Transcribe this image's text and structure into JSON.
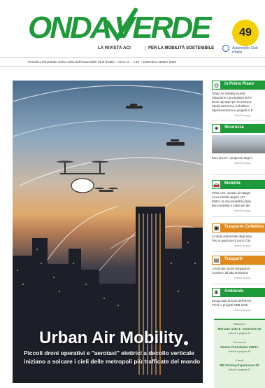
{
  "masthead": {
    "logo_left": "ONDA",
    "logo_right": "VERDE",
    "issue_number": "49",
    "tagline_left": "LA RIVISTA ACI",
    "tagline_right": "PER LA MOBILITÀ SOSTENIBILE",
    "aci_label": "Automobile Club d'Italia",
    "subtitle": "Periodico bimestrale online edito dall'Automobile Club d'Italia – Anno IX – n.49 – settembre-ottobre 2025",
    "brand_color": "#1f9a3b",
    "badge_color": "#f5d000"
  },
  "cover": {
    "title": "Urban Air Mobility",
    "subtitle_line1": "Piccoli droni operativi e \"aerotaxi\" elettrici a decollo verticale",
    "subtitle_line2": "iniziano a solcare i cieli delle metropoli più trafficate del mondo"
  },
  "sidebar": {
    "sections": [
      {
        "icon": "target-icon",
        "label": "In Primo Piano",
        "lines": [
          "Urban Air Mobility (UAM):",
          "Situazione e prospettive del m",
          "Droni operativi per la sicurezz",
          "Studio McKinsey sull'utilizzo",
          "Sperimentazioni e progetti in E"
        ],
        "more": "Articoli da pag"
      },
      {
        "icon": "car-crash-icon",
        "label": "Sicurezza",
        "lines": [
          "Euro NCAP: i progressi degli A"
        ],
        "more": "Articoli da pag"
      },
      {
        "icon": "car-icon",
        "label": "Mobilità",
        "lines": [
          "PSCL ACI: mutatis di Indagin",
          "Al via il Madì targato ACI",
          "ENEA: la micromobilità urban",
          "Micromobilità e tutela del dis"
        ],
        "more": "Articoli da pag"
      },
      {
        "icon": "bus-icon",
        "label": "Trasporto Collettivo",
        "lines": [
          "La sfida ambientale degli intra",
          "Tesi in guida per il Lion's City"
        ],
        "more": "Articoli da pag"
      },
      {
        "icon": "train-icon",
        "label": "Trasporti",
        "lines": [
          "I rischi del nuovo bargagli-ve",
          "Crociere: ad alta emissione"
        ],
        "more": "Articoli da pag"
      },
      {
        "icon": "leaf-icon",
        "label": "Ambiente",
        "lines": [
          "Smog sotto la lente dell'ISTAT",
          "Premi e progetti NEB 2025"
        ],
        "more": "Articoli da pag"
      }
    ],
    "box": [
      {
        "small": "Statistiche",
        "bold": "Mercato auto 1° semestre 20",
        "more": "Articoli a pagina 44"
      },
      {
        "small": "Documenti",
        "bold": "Nuovo Presidente ANFIA",
        "more": "Articoli a pagina 45"
      },
      {
        "small": "Eventi",
        "bold": "BE Driving Experience 20",
        "more": "Articoli a pagina 47"
      }
    ]
  }
}
